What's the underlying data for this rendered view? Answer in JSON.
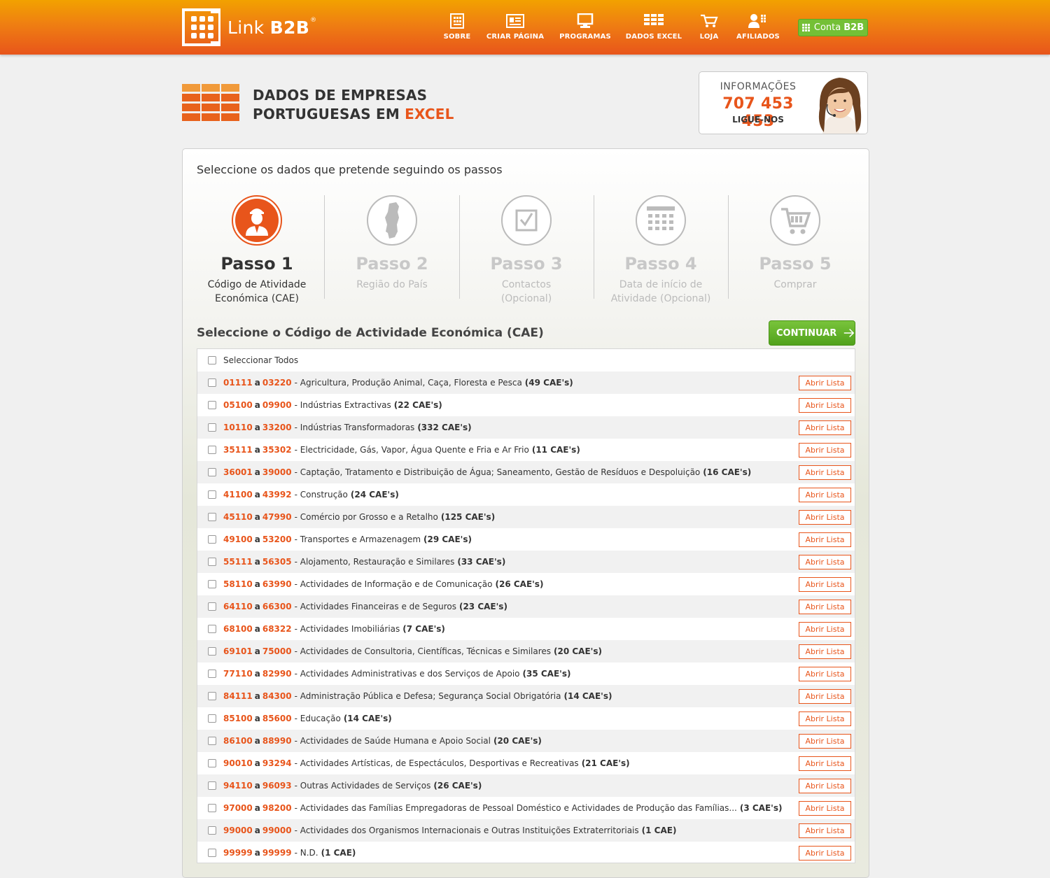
{
  "brand": {
    "name_prefix": "Link",
    "name_bold": "B2B",
    "reg": "®"
  },
  "nav": [
    {
      "label": "SOBRE",
      "icon": "document-icon"
    },
    {
      "label": "CRIAR PÁGINA",
      "icon": "profile-page-icon"
    },
    {
      "label": "PROGRAMAS",
      "icon": "monitor-icon"
    },
    {
      "label": "DADOS EXCEL",
      "icon": "spreadsheet-icon"
    },
    {
      "label": "LOJA",
      "icon": "cart-icon"
    },
    {
      "label": "AFILIADOS",
      "icon": "users-icon"
    }
  ],
  "account": {
    "label": "Conta",
    "label_bold": "B2B"
  },
  "title": {
    "line1": "DADOS DE EMPRESAS",
    "line2_prefix": "PORTUGUESAS EM",
    "line2_highlight": "EXCEL"
  },
  "info": {
    "label": "INFORMAÇÕES",
    "phone": "707 453 453",
    "call": "LIGUE-NOS"
  },
  "intro": "Seleccione os dados que pretende seguindo os passos",
  "steps": [
    {
      "number": "Passo 1",
      "desc1": "Código de Atividade",
      "desc2": "Económica (CAE)",
      "icon": "worker-icon",
      "active": true
    },
    {
      "number": "Passo 2",
      "desc1": "Região do País",
      "desc2": "",
      "icon": "portugal-map-icon",
      "active": false
    },
    {
      "number": "Passo 3",
      "desc1": "Contactos",
      "desc2": "(Opcional)",
      "icon": "checkbox-icon",
      "active": false
    },
    {
      "number": "Passo 4",
      "desc1": "Data de início de",
      "desc2": "Atividade  (Opcional)",
      "icon": "calendar-icon",
      "active": false
    },
    {
      "number": "Passo 5",
      "desc1": "Comprar",
      "desc2": "",
      "icon": "cart-icon",
      "active": false
    }
  ],
  "section_title": "Seleccione o Código de Actividade Económica (CAE)",
  "continue_label": "CONTINUAR",
  "select_all": "Seleccionar Todos",
  "a_word": "a",
  "open_label": "Abrir Lista",
  "cae_rows": [
    {
      "from": "01111",
      "to": "03220",
      "desc": "- Agricultura, Produção Animal, Caça, Floresta e Pesca",
      "count": "(49 CAE's)"
    },
    {
      "from": "05100",
      "to": "09900",
      "desc": "- Indústrias Extractivas",
      "count": "(22 CAE's)"
    },
    {
      "from": "10110",
      "to": "33200",
      "desc": "- Indústrias Transformadoras",
      "count": "(332 CAE's)"
    },
    {
      "from": "35111",
      "to": "35302",
      "desc": "- Electricidade, Gás, Vapor, Água Quente e Fria e Ar Frio",
      "count": "(11 CAE's)"
    },
    {
      "from": "36001",
      "to": "39000",
      "desc": "- Captação, Tratamento e Distribuição de Água; Saneamento, Gestão de Resíduos e Despoluição",
      "count": "(16 CAE's)"
    },
    {
      "from": "41100",
      "to": "43992",
      "desc": "- Construção",
      "count": "(24 CAE's)"
    },
    {
      "from": "45110",
      "to": "47990",
      "desc": "- Comércio por Grosso e a Retalho",
      "count": "(125 CAE's)"
    },
    {
      "from": "49100",
      "to": "53200",
      "desc": "- Transportes e Armazenagem",
      "count": "(29 CAE's)"
    },
    {
      "from": "55111",
      "to": "56305",
      "desc": "- Alojamento, Restauração e Similares",
      "count": "(33 CAE's)"
    },
    {
      "from": "58110",
      "to": "63990",
      "desc": "- Actividades de Informação e de Comunicação",
      "count": "(26 CAE's)"
    },
    {
      "from": "64110",
      "to": "66300",
      "desc": "- Actividades Financeiras e de Seguros",
      "count": "(23 CAE's)"
    },
    {
      "from": "68100",
      "to": "68322",
      "desc": "- Actividades Imobiliárias",
      "count": "(7 CAE's)"
    },
    {
      "from": "69101",
      "to": "75000",
      "desc": "- Actividades de Consultoria, Científicas, Técnicas e Similares",
      "count": "(20 CAE's)"
    },
    {
      "from": "77110",
      "to": "82990",
      "desc": "- Actividades Administrativas e dos Serviços de Apoio",
      "count": "(35 CAE's)"
    },
    {
      "from": "84111",
      "to": "84300",
      "desc": "- Administração Pública e Defesa; Segurança Social Obrigatória",
      "count": "(14 CAE's)"
    },
    {
      "from": "85100",
      "to": "85600",
      "desc": "- Educação",
      "count": "(14 CAE's)"
    },
    {
      "from": "86100",
      "to": "88990",
      "desc": "- Actividades de Saúde Humana e Apoio Social",
      "count": "(20 CAE's)"
    },
    {
      "from": "90010",
      "to": "93294",
      "desc": "- Actividades Artísticas, de Espectáculos, Desportivas e Recreativas",
      "count": "(21 CAE's)"
    },
    {
      "from": "94110",
      "to": "96093",
      "desc": "- Outras Actividades de Serviços",
      "count": "(26 CAE's)"
    },
    {
      "from": "97000",
      "to": "98200",
      "desc": "- Actividades das Famílias Empregadoras de Pessoal Doméstico e Actividades de Produção das Famílias...",
      "count": "(3 CAE's)"
    },
    {
      "from": "99000",
      "to": "99000",
      "desc": "- Actividades dos Organismos Internacionais e Outras Instituições Extraterritoriais",
      "count": "(1 CAE)"
    },
    {
      "from": "99999",
      "to": "99999",
      "desc": "- N.D.",
      "count": "(1 CAE)"
    }
  ],
  "colors": {
    "accent": "#e8551b",
    "header_top": "#f2a200",
    "green": "#74c036"
  }
}
